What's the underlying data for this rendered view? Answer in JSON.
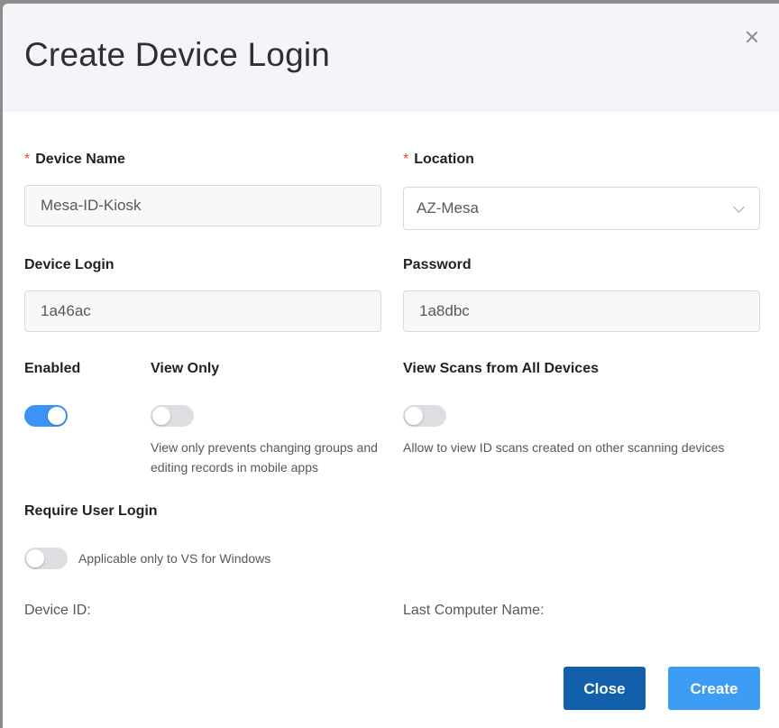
{
  "modal": {
    "title": "Create Device Login",
    "close_icon": "close-icon"
  },
  "form": {
    "device_name": {
      "label": "Device Name",
      "required_mark": "*",
      "value": "Mesa-ID-Kiosk"
    },
    "location": {
      "label": "Location",
      "required_mark": "*",
      "selected": "AZ-Mesa",
      "icon": "chevron-down-icon"
    },
    "device_login": {
      "label": "Device Login",
      "value": "1a46ac"
    },
    "password": {
      "label": "Password",
      "value": "1a8dbc"
    },
    "enabled": {
      "label": "Enabled",
      "on": true
    },
    "view_only": {
      "label": "View Only",
      "on": false,
      "help": "View only prevents changing groups and editing records in mobile apps"
    },
    "view_scans_all": {
      "label": "View Scans from All Devices",
      "on": false,
      "help": "Allow to view ID scans created on other scanning devices"
    },
    "require_user_login": {
      "label": "Require User Login",
      "on": false,
      "help": "Applicable only to VS for Windows"
    },
    "device_id_label": "Device ID:",
    "last_computer_label": "Last Computer Name:"
  },
  "buttons": {
    "close": "Close",
    "create": "Create"
  },
  "colors": {
    "accent": "#3d93f5",
    "close_button": "#1260ac",
    "create_button": "#3d9cf3",
    "required": "#e5483f"
  }
}
